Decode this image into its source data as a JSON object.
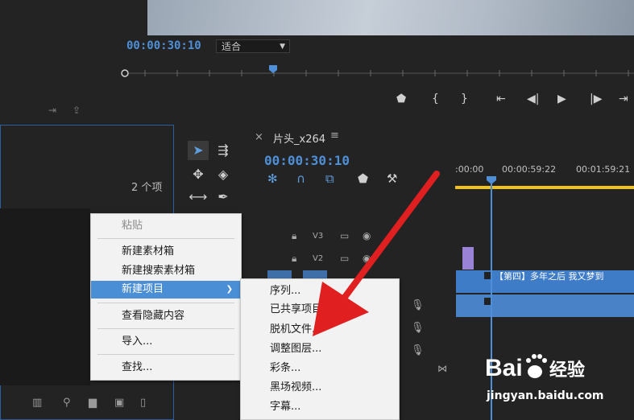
{
  "program_monitor": {
    "timecode": "00:00:30:10",
    "fit_option": "适合"
  },
  "project_panel": {
    "item_count": "2 个项"
  },
  "timeline": {
    "sequence_name": "片头_x264",
    "timecode": "00:00:30:10",
    "ruler_labels": [
      ":00:00",
      "00:00:59:22",
      "00:01:59:21"
    ],
    "tracks": [
      {
        "name": "V3"
      },
      {
        "name": "V2"
      }
    ],
    "clip_title": "【第四】多年之后 我又梦到"
  },
  "context_menu": {
    "items": [
      {
        "label": "粘贴",
        "disabled": true
      },
      {
        "label": "新建素材箱"
      },
      {
        "label": "新建搜索素材箱"
      },
      {
        "label": "新建项目",
        "highlighted": true
      },
      {
        "label": "查看隐藏内容"
      },
      {
        "label": "导入..."
      },
      {
        "label": "查找..."
      }
    ]
  },
  "submenu": {
    "items": [
      {
        "label": "序列..."
      },
      {
        "label": "已共享项目..."
      },
      {
        "label": "脱机文件..."
      },
      {
        "label": "调整图层..."
      },
      {
        "label": "彩条..."
      },
      {
        "label": "黑场视频..."
      },
      {
        "label": "字幕..."
      }
    ]
  },
  "watermark": {
    "logo_text": "Bai 经验",
    "url": "jingyan.baidu.com"
  },
  "colors": {
    "accent_blue": "#4f8fd8",
    "menu_highlight": "#4a8ed6",
    "work_area_yellow": "#f2c21b",
    "annotation_red": "#e02020"
  }
}
